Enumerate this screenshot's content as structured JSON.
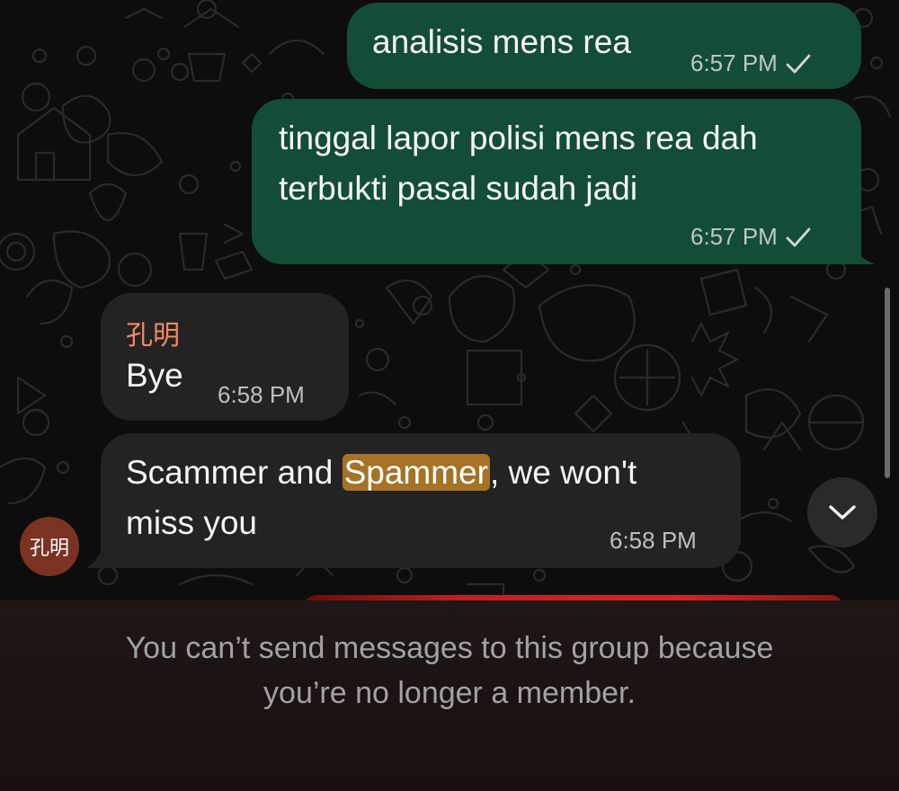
{
  "messages": [
    {
      "text": "analisis mens rea",
      "time": "6:57 PM",
      "status_icon": "check-icon"
    },
    {
      "text": "tinggal lapor polisi mens rea dah\nterbukti pasal sudah jadi",
      "time": "6:57 PM",
      "status_icon": "check-icon"
    },
    {
      "sender": "孔明",
      "text": "Bye",
      "time": "6:58 PM"
    },
    {
      "text_before": "Scammer and ",
      "highlight": "Spammer",
      "text_after": ", we won't\nmiss you",
      "time": "6:58 PM"
    }
  ],
  "avatar": {
    "label": "孔明",
    "color": "#7a3322"
  },
  "footer": {
    "notice": "You can’t send messages to this group because\nyou’re no longer a member."
  },
  "colors": {
    "outgoing_bubble": "#144d37",
    "incoming_bubble": "#232323",
    "sender_name": "#f08a67",
    "highlight": "#a67226"
  }
}
